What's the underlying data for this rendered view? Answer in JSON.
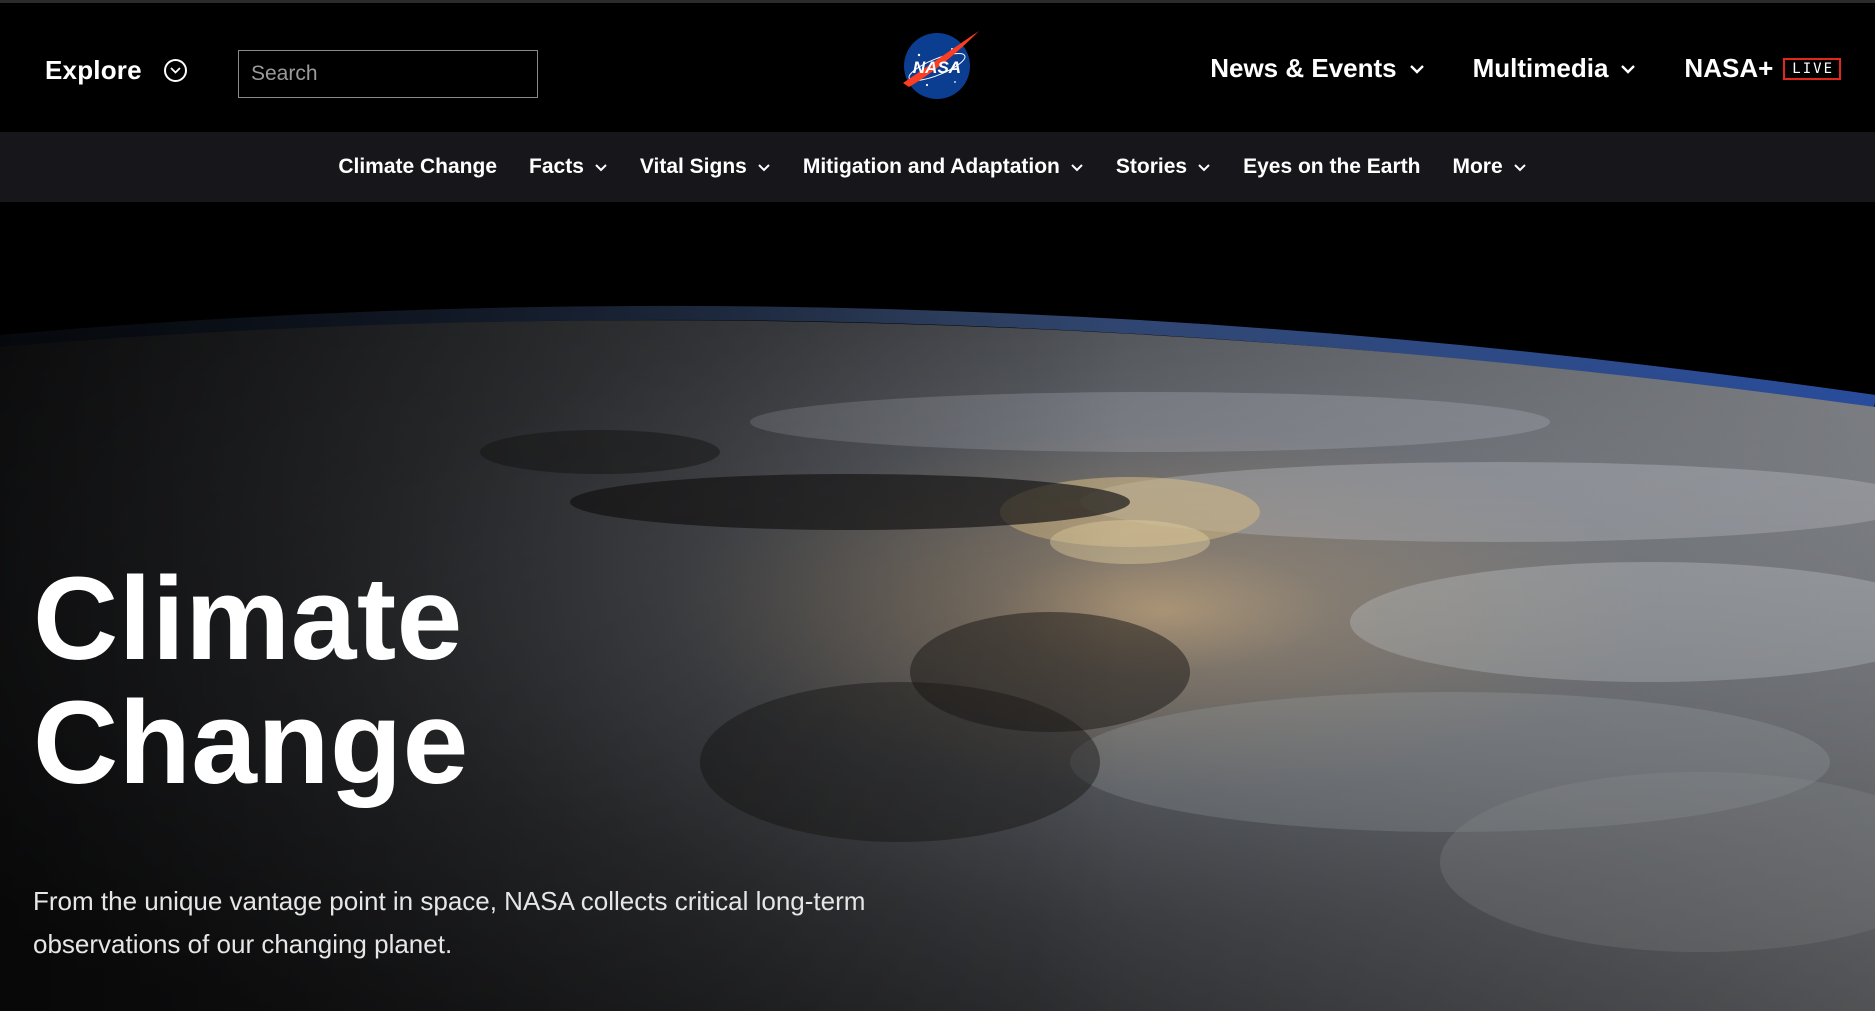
{
  "header": {
    "explore_label": "Explore",
    "search_placeholder": "Search",
    "logo_text": "NASA",
    "nav": [
      {
        "label": "News & Events",
        "has_dropdown": true
      },
      {
        "label": "Multimedia",
        "has_dropdown": true
      },
      {
        "label": "NASA+",
        "badge": "LIVE"
      }
    ]
  },
  "subnav": {
    "items": [
      {
        "label": "Climate Change",
        "has_dropdown": false
      },
      {
        "label": "Facts",
        "has_dropdown": true
      },
      {
        "label": "Vital Signs",
        "has_dropdown": true
      },
      {
        "label": "Mitigation and Adaptation",
        "has_dropdown": true
      },
      {
        "label": "Stories",
        "has_dropdown": true
      },
      {
        "label": "Eyes on the Earth",
        "has_dropdown": false
      },
      {
        "label": "More",
        "has_dropdown": true
      }
    ]
  },
  "hero": {
    "title_line1": "Climate",
    "title_line2": "Change",
    "description": "From the unique vantage point in space, NASA collects critical long-term observations of our changing planet."
  },
  "colors": {
    "header_bg": "#000000",
    "subnav_bg": "#17171b",
    "live_badge_border": "#e4271c",
    "nasa_blue": "#0b3d91",
    "nasa_red": "#fc3d21"
  },
  "icons": {
    "explore": "chevron-circle-down-icon",
    "dropdown": "chevron-down-icon"
  }
}
